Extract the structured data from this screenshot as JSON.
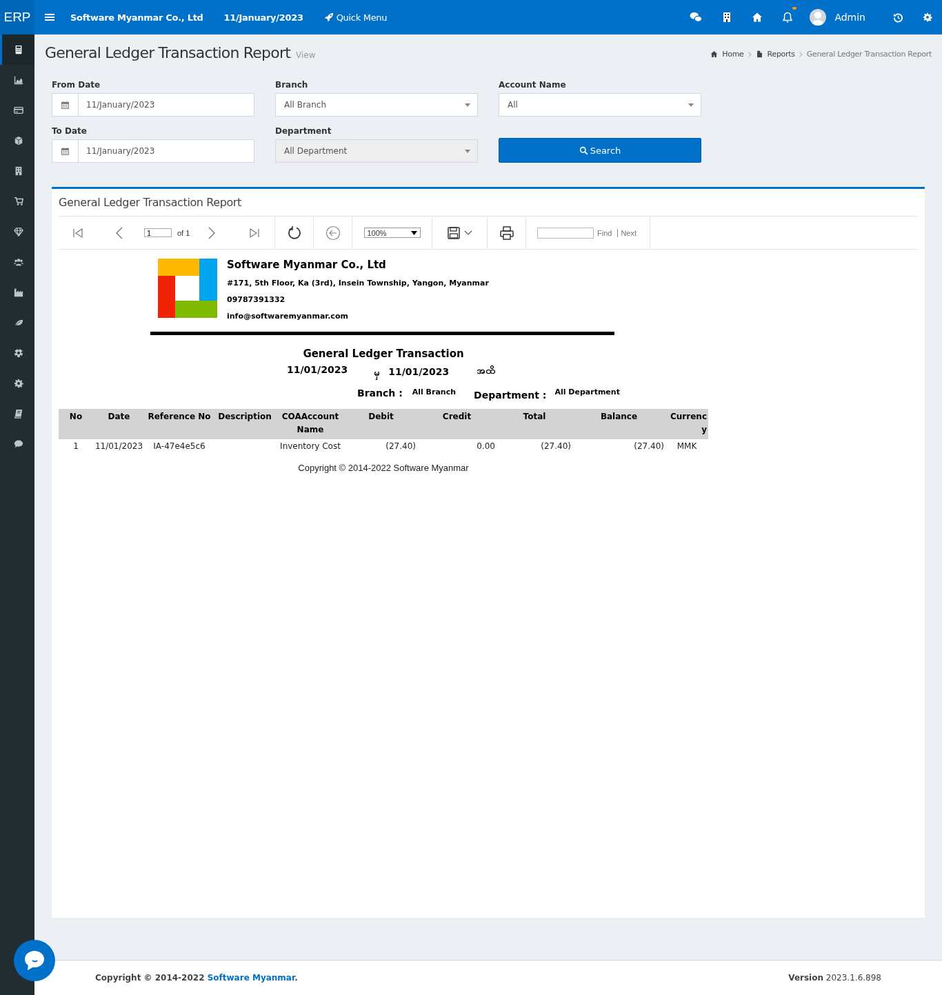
{
  "topbar": {
    "logo": "ERP",
    "company": "Software Myanmar Co., Ltd",
    "date": "11/January/2023",
    "quick_menu": "Quick Menu",
    "notification_dot": true,
    "user": "Admin"
  },
  "sidebar": {
    "items": [
      {
        "selected": true
      },
      {
        "selected": false
      },
      {
        "selected": false
      },
      {
        "selected": false
      },
      {
        "selected": false
      },
      {
        "selected": false
      },
      {
        "selected": false
      },
      {
        "selected": false
      },
      {
        "selected": false
      },
      {
        "selected": false
      },
      {
        "selected": false
      },
      {
        "selected": false
      },
      {
        "selected": false
      },
      {
        "selected": false
      }
    ]
  },
  "page": {
    "title": "General Ledger Transaction Report",
    "subtitle": "View",
    "breadcrumb": [
      "Home",
      "Reports",
      "General Ledger Transaction Report"
    ]
  },
  "filters": {
    "from_date": {
      "label": "From Date",
      "value": "11/January/2023"
    },
    "branch": {
      "label": "Branch",
      "value": "All Branch",
      "disabled": false
    },
    "account_name": {
      "label": "Account Name",
      "value": "All",
      "disabled": false
    },
    "to_date": {
      "label": "To Date",
      "value": "11/January/2023"
    },
    "department": {
      "label": "Department",
      "value": "All Department",
      "disabled": true
    },
    "search_button": "Search"
  },
  "panel": {
    "title": "General Ledger Transaction Report",
    "viewer_toolbar": {
      "page": "1",
      "page_count": "of 1",
      "zoom": "100%",
      "find": "Find",
      "next": "Next"
    },
    "report": {
      "company": "Software Myanmar Co., Ltd",
      "address": "#171, 5th Floor, Ka (3rd), Insein Township, Yangon, Myanmar",
      "phone": "09787391332",
      "email": "info@softwaremyanmar.com",
      "title": "General Ledger Transaction",
      "from_date": "11/01/2023",
      "from_word": "မှ",
      "to_date": "11/01/2023",
      "to_word": "အထိ",
      "branch_label": "Branch :",
      "branch_value": "All Branch",
      "department_label": "Department :",
      "department_value": "All Department",
      "table": {
        "columns": [
          "No",
          "Date",
          "Reference No",
          "Description",
          "COAAccount Name",
          "Debit",
          "Credit",
          "Total",
          "Balance",
          "Currency"
        ],
        "rows": [
          [
            "1",
            "11/01/2023",
            "IA-47e4e5c6",
            "",
            "Inventory Cost",
            "(27.40)",
            "0.00",
            "(27.40)",
            "(27.40)",
            "MMK"
          ]
        ]
      },
      "copyright": "Copyright © 2014-2022 Software Myanmar"
    }
  },
  "footer": {
    "copyright": "Copyright © 2014-2022 ",
    "link": "Software Myanmar",
    "end": ".",
    "version": "**Version** 2023.1.6.898"
  }
}
